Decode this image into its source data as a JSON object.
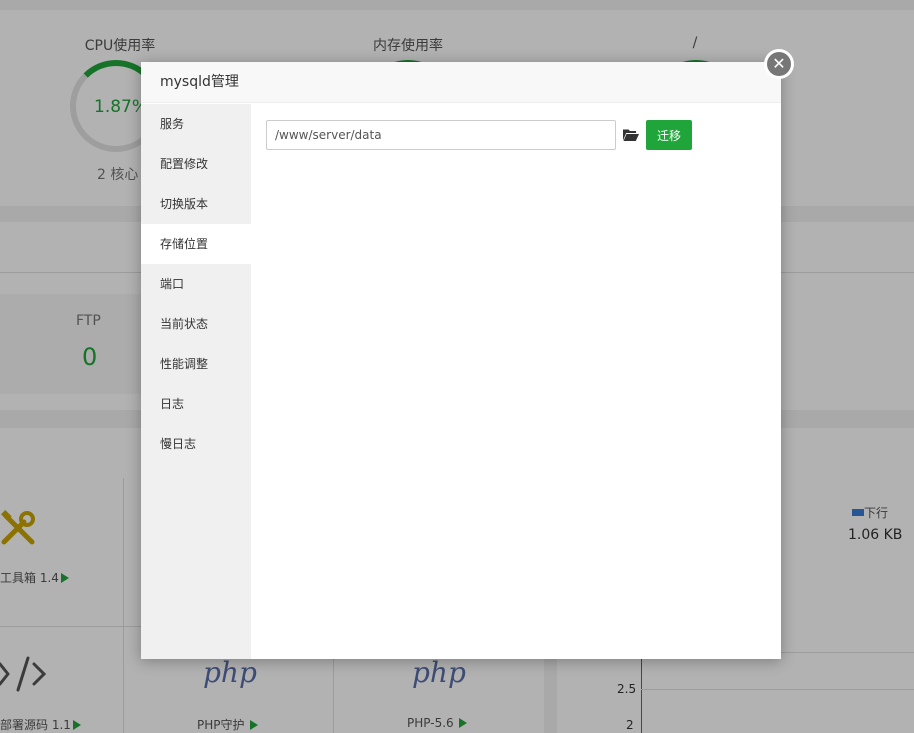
{
  "background": {
    "gauges": [
      {
        "title": "CPU使用率",
        "value": "1.87%",
        "sub": "2 核心"
      },
      {
        "title": "内存使用率"
      },
      {
        "title": "/"
      }
    ],
    "stats": [
      {
        "label": "FTP",
        "value": "0"
      }
    ],
    "software": [
      {
        "label": "工具箱 1.4"
      },
      {
        "label": "部署源码 1.1"
      },
      {
        "label": "PHP守护"
      },
      {
        "label": "PHP-5.6"
      }
    ],
    "php_logo_text": "php",
    "network": {
      "legend_down": "下行",
      "down_value": "1.06 KB",
      "y_ticks": [
        "2.5",
        "2"
      ]
    }
  },
  "modal": {
    "title": "mysqld管理",
    "close_symbol": "✕",
    "sidebar": [
      {
        "label": "服务"
      },
      {
        "label": "配置修改"
      },
      {
        "label": "切换版本"
      },
      {
        "label": "存储位置",
        "active": true
      },
      {
        "label": "端口"
      },
      {
        "label": "当前状态"
      },
      {
        "label": "性能调整"
      },
      {
        "label": "日志"
      },
      {
        "label": "慢日志"
      }
    ],
    "storage": {
      "path_value": "/www/server/data",
      "migrate_label": "迁移"
    }
  },
  "colors": {
    "accent": "#20a53a",
    "overlay": "rgba(0,0,0,0.3)",
    "legend_down": "#3a7bd5"
  },
  "icons": {
    "folder": "folder-open-icon",
    "close": "close-icon",
    "tools": "tools-icon",
    "code": "code-icon"
  }
}
